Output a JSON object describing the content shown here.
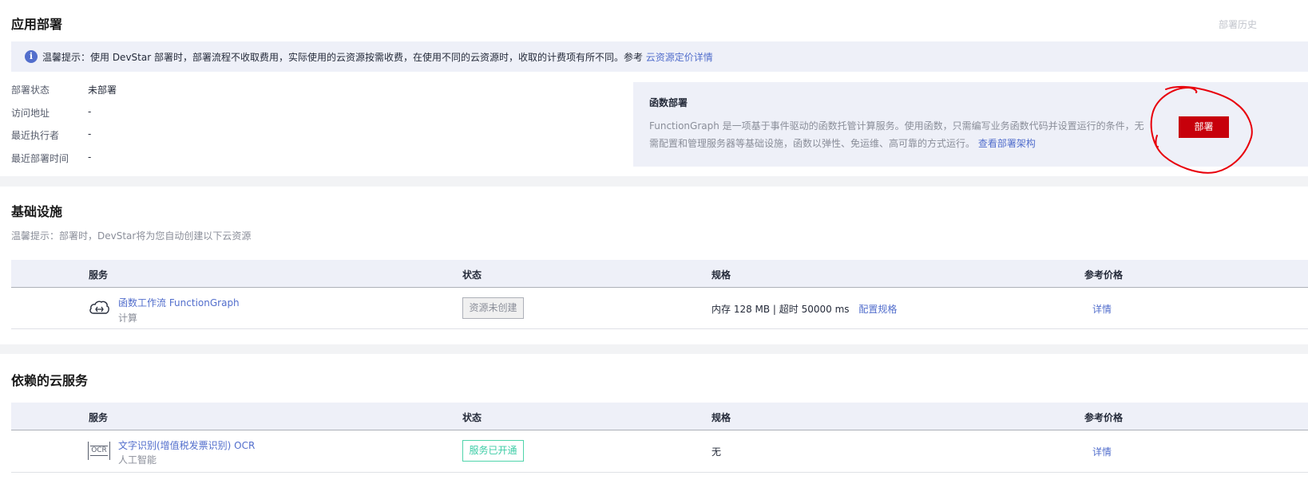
{
  "header": {
    "title": "应用部署",
    "history_link": "部署历史"
  },
  "tip": {
    "text": "温馨提示：使用 DevStar 部署时，部署流程不收取费用，实际使用的云资源按需收费，在使用不同的云资源时，收取的计费项有所不同。参考",
    "link": "云资源定价详情"
  },
  "deploy_info": {
    "status_label": "部署状态",
    "status_value": "未部署",
    "url_label": "访问地址",
    "url_value": "-",
    "executor_label": "最近执行者",
    "executor_value": "-",
    "time_label": "最近部署时间",
    "time_value": "-"
  },
  "function_deploy": {
    "title": "函数部署",
    "desc_line1": "FunctionGraph 是一项基于事件驱动的函数托管计算服务。使用函数，只需编写业务函数代码并设置运行的条件，无",
    "desc_line2": "需配置和管理服务器等基础设施，函数以弹性、免运维、高可靠的方式运行。",
    "link": "查看部署架构",
    "button_label": "部署"
  },
  "infrastructure": {
    "title": "基础设施",
    "tip": "温馨提示：部署时，DevStar将为您自动创建以下云资源",
    "columns": [
      "服务",
      "状态",
      "规格",
      "参考价格"
    ],
    "rows": [
      {
        "icon": "cloud-function-icon",
        "name": "函数工作流 FunctionGraph",
        "category": "计算",
        "status": "资源未创建",
        "spec": "内存 128 MB | 超时 50000 ms",
        "spec_link": "配置规格",
        "price_link": "详情"
      }
    ]
  },
  "dependencies": {
    "title": "依赖的云服务",
    "columns": [
      "服务",
      "状态",
      "规格",
      "参考价格"
    ],
    "rows": [
      {
        "icon": "ocr-icon",
        "icon_text": "OCR",
        "name": "文字识别(增值税发票识别) OCR",
        "category": "人工智能",
        "status": "服务已开通",
        "spec": "无",
        "price_link": "详情"
      }
    ]
  },
  "colors": {
    "accent": "#526ecc",
    "primary_button": "#c7000b",
    "annotation": "#e8000b",
    "success": "#3dcca6"
  }
}
